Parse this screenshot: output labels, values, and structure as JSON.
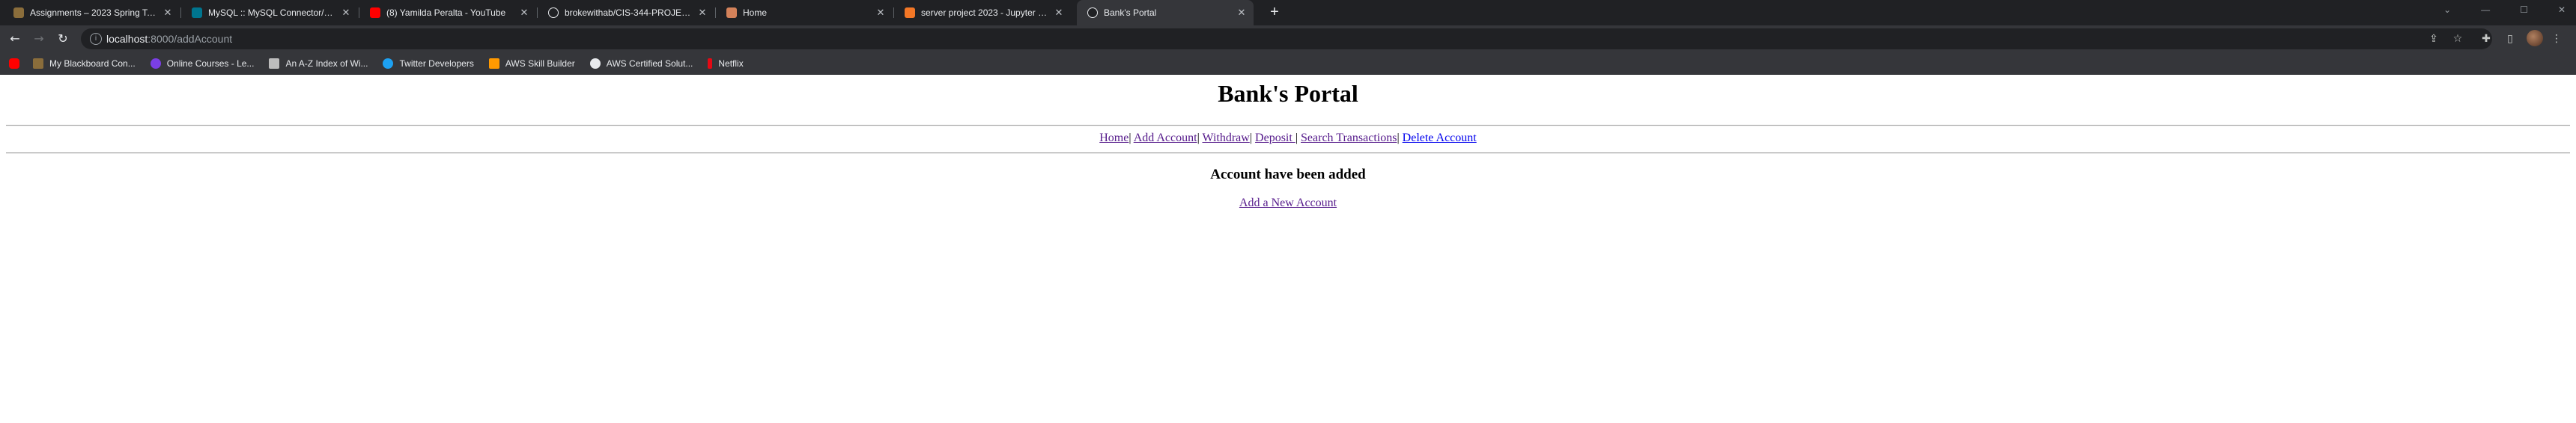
{
  "browser": {
    "tabs": [
      {
        "label": "Assignments – 2023 Spring Term",
        "favicon_color": "#8a6d3b"
      },
      {
        "label": "MySQL :: MySQL Connector/Pyth",
        "favicon_color": "#00758f"
      },
      {
        "label": "(8) Yamilda Peralta - YouTube",
        "favicon_color": "#ff0000"
      },
      {
        "label": "brokewithab/CIS-344-PROJECT-2",
        "favicon_color": "#f0f0f0"
      },
      {
        "label": "Home",
        "favicon_color": "#d4825a"
      },
      {
        "label": "server project 2023 - Jupyter Not",
        "favicon_color": "#f37726"
      },
      {
        "label": "Bank's Portal",
        "favicon_color": "#e8eaed"
      }
    ],
    "address": {
      "host": "localhost",
      "path": ":8000/addAccount"
    },
    "bookmarks": [
      {
        "label": "",
        "icon_color": "#ff0000"
      },
      {
        "label": "My Blackboard Con...",
        "icon_color": "#8a6d3b"
      },
      {
        "label": "Online Courses - Le...",
        "icon_color": "#7b3fe4"
      },
      {
        "label": "An A-Z Index of Wi...",
        "icon_color": "#bdbdbd"
      },
      {
        "label": "Twitter Developers",
        "icon_color": "#1da1f2"
      },
      {
        "label": "AWS Skill Builder",
        "icon_color": "#ff9900"
      },
      {
        "label": "AWS Certified Solut...",
        "icon_color": "#e8eaed"
      },
      {
        "label": "Netflix",
        "icon_color": "#e50914"
      }
    ]
  },
  "page": {
    "title": "Bank's Portal",
    "nav": {
      "home": "Home",
      "add_account": "Add Account",
      "withdraw": "Withdraw",
      "deposit": "Deposit ",
      "search": "Search Transactions",
      "delete": "Delete Account",
      "sep": "|"
    },
    "message": "Account have been added",
    "add_new_link": "Add a New Account"
  }
}
